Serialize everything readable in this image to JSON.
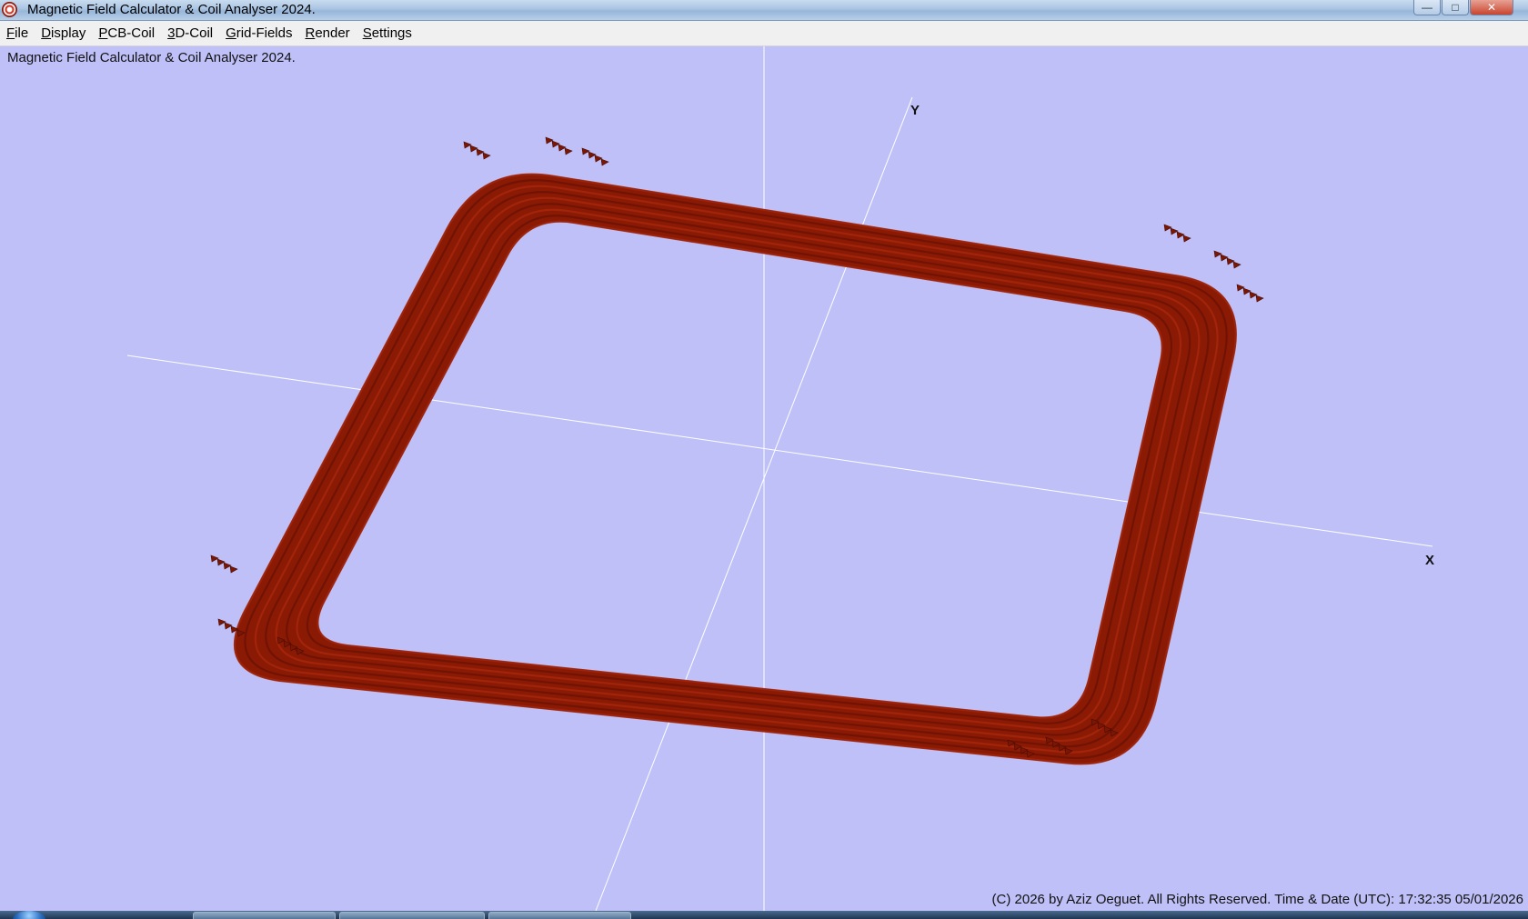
{
  "window": {
    "title": "Magnetic Field Calculator & Coil Analyser 2024.",
    "controls": {
      "minimize": "—",
      "maximize": "□",
      "close": "✕"
    }
  },
  "menu": [
    {
      "accel": "F",
      "rest": "ile"
    },
    {
      "accel": "D",
      "rest": "isplay"
    },
    {
      "accel": "P",
      "rest": "CB-Coil"
    },
    {
      "accel": "3",
      "rest": "D-Coil"
    },
    {
      "accel": "G",
      "rest": "rid-Fields"
    },
    {
      "accel": "R",
      "rest": "ender"
    },
    {
      "accel": "S",
      "rest": "ettings"
    }
  ],
  "viewport": {
    "overlay_title": "Magnetic Field Calculator & Coil Analyser 2024.",
    "axis_x_label": "X",
    "axis_y_label": "Y",
    "status": "(C) 2026  by Aziz Oeguet. All Rights Reserved.  Time & Date (UTC): 17:32:35  05/01/2026",
    "background_color": "#bfc0f8",
    "coil_color": "#8b1a05",
    "coil_edge_color": "#5e0f02",
    "axis_color": "#ffffff",
    "coil_turns": 9
  }
}
